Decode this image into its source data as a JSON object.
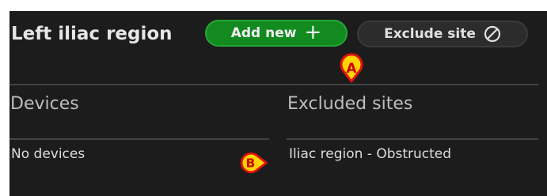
{
  "section": {
    "title": "Left iliac region",
    "add_new_label": "Add new",
    "add_new_icon": "plus-icon",
    "exclude_site_label": "Exclude site",
    "exclude_site_icon": "ban-icon"
  },
  "columns": {
    "devices": {
      "header": "Devices",
      "value": "No devices"
    },
    "excluded_sites": {
      "header": "Excluded sites",
      "value": "Iliac region - Obstructed"
    }
  },
  "annotations": {
    "a": "A",
    "b": "B"
  },
  "colors": {
    "panel_bg": "#1c1c1c",
    "add_button": "#138a1f",
    "exclude_button": "#2c2c2c",
    "marker_fill": "#ffd400",
    "marker_border": "#e01010",
    "marker_text": "#cc0000"
  }
}
